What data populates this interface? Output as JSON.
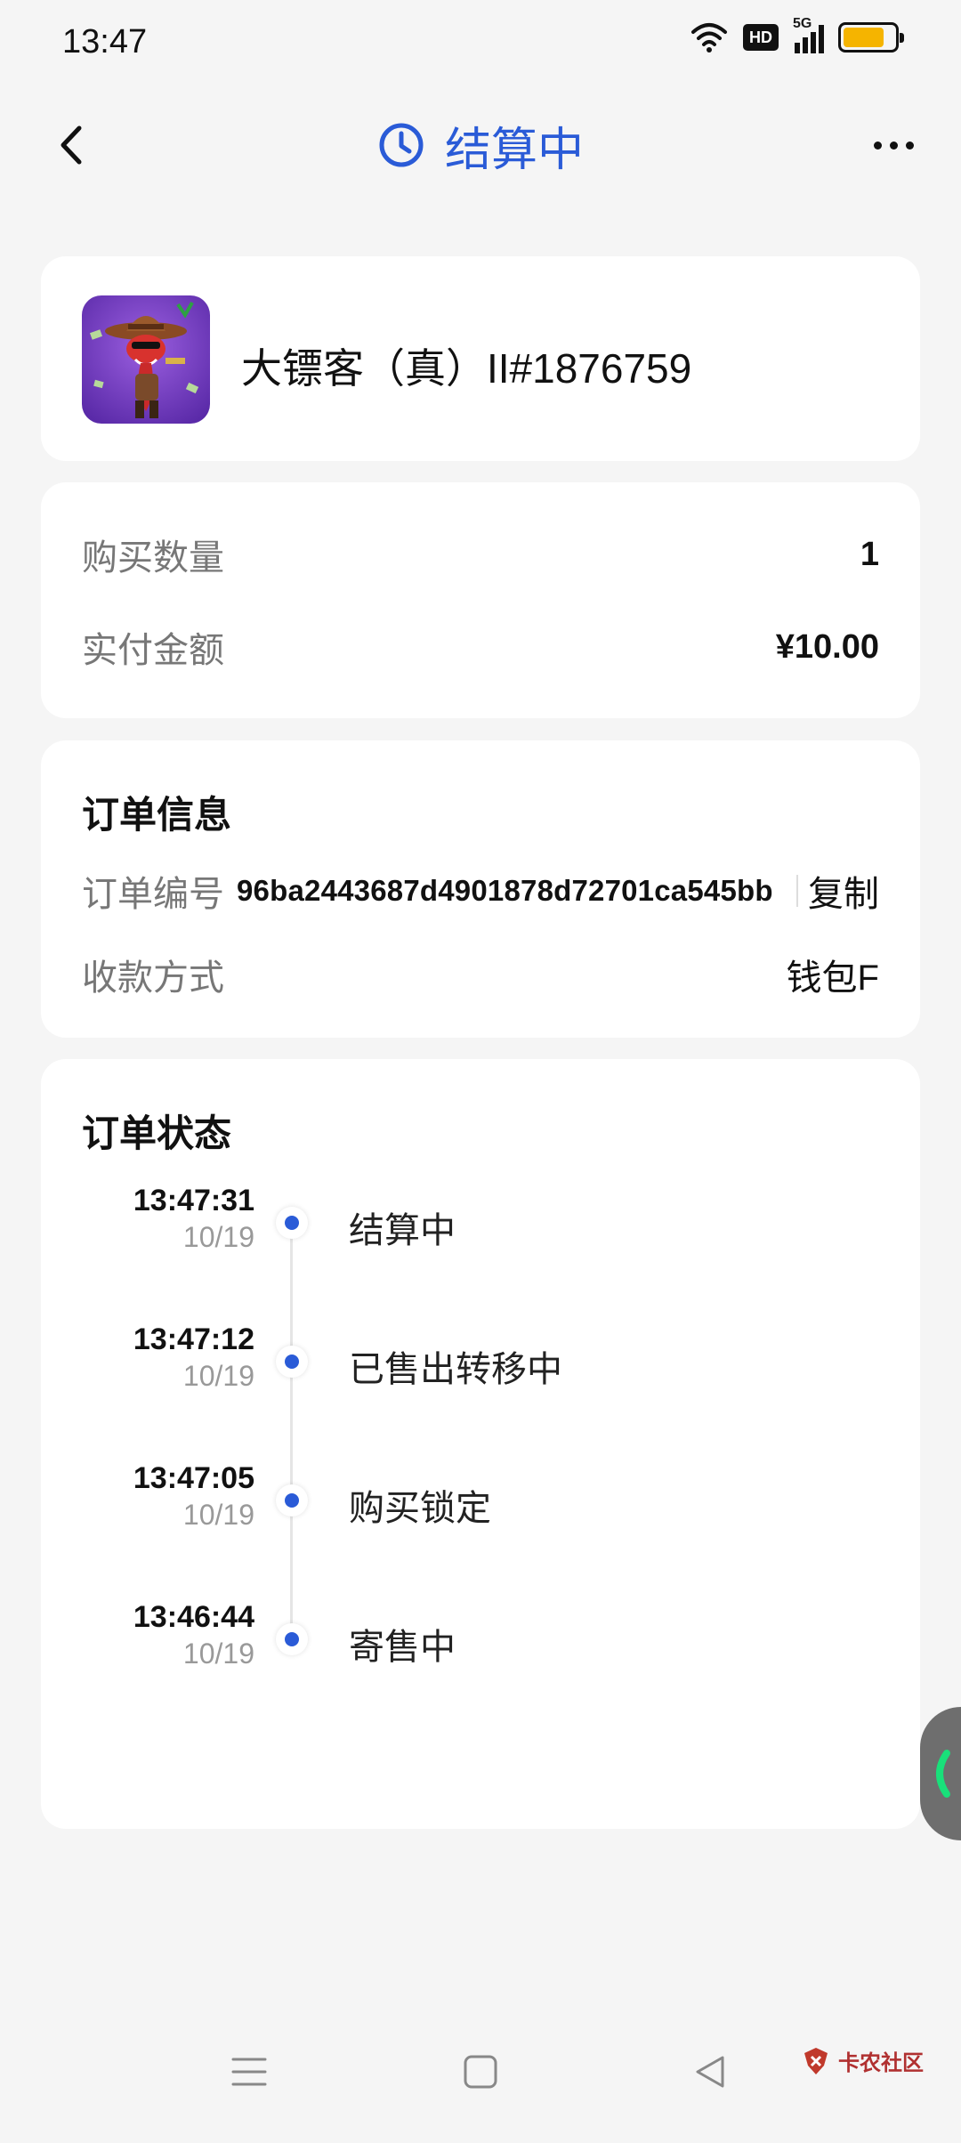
{
  "status_bar": {
    "time": "13:47",
    "hd_label": "HD",
    "net_label": "5G",
    "battery_level": 0.8
  },
  "header": {
    "title": "结算中",
    "back_icon": "chevron-left-icon",
    "status_icon": "clock-icon",
    "more_icon": "more-horizontal-icon"
  },
  "product": {
    "name": "大镖客（真）II#1876759",
    "thumbnail_icon": "cowboy-snake-art"
  },
  "amounts": {
    "quantity_label": "购买数量",
    "quantity_value": "1",
    "paid_label": "实付金额",
    "paid_value": "¥10.00"
  },
  "order_info": {
    "title": "订单信息",
    "order_no_label": "订单编号",
    "order_no_value": "96ba2443687d4901878d72701ca545bb",
    "copy_label": "复制",
    "payment_label": "收款方式",
    "payment_value": "钱包F"
  },
  "order_status": {
    "title": "订单状态",
    "events": [
      {
        "time": "13:47:31",
        "date": "10/19",
        "label": "结算中"
      },
      {
        "time": "13:47:12",
        "date": "10/19",
        "label": "已售出转移中"
      },
      {
        "time": "13:47:05",
        "date": "10/19",
        "label": "购买锁定"
      },
      {
        "time": "13:46:44",
        "date": "10/19",
        "label": "寄售中"
      }
    ]
  },
  "watermark": {
    "text": "卡农社区"
  },
  "colors": {
    "accent": "#2a5bd7",
    "background": "#f5f5f5",
    "card": "#ffffff",
    "muted_text": "#777777",
    "battery": "#f5b400"
  }
}
